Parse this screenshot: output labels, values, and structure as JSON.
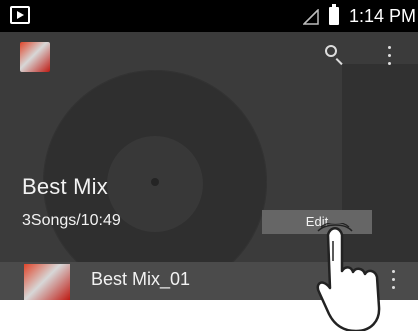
{
  "status_bar": {
    "time": "1:14 PM"
  },
  "playlist": {
    "title": "Best Mix",
    "meta": "3Songs/10:49",
    "edit_label": "Edit"
  },
  "songs": [
    {
      "title": "Best Mix_01"
    }
  ],
  "icons": {
    "app": "app-logo-icon",
    "search": "search-icon",
    "more": "more-vert-icon",
    "status_play": "play-store-icon",
    "signal": "signal-icon",
    "battery": "battery-icon"
  },
  "colors": {
    "background": "#3a3a3a",
    "status_bar": "#000000",
    "button": "#666666",
    "accent": "#d83a24"
  }
}
